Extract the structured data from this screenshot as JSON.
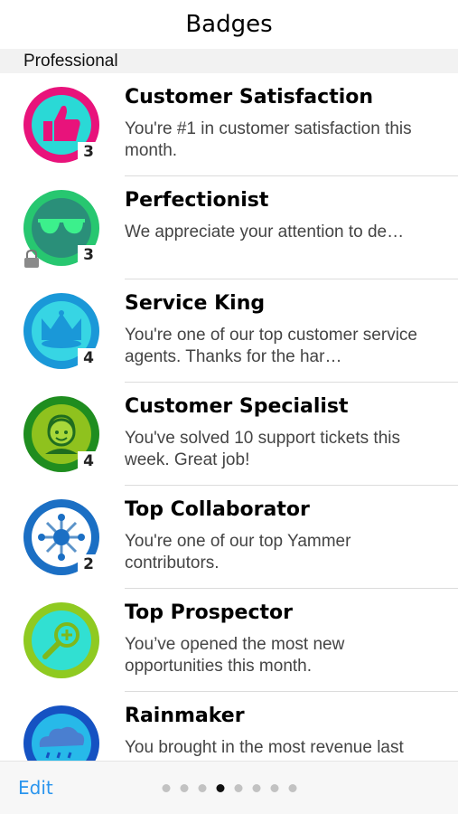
{
  "header": {
    "title": "Badges"
  },
  "section": {
    "label": "Professional"
  },
  "badges": [
    {
      "title": "Customer Satisfaction",
      "desc": "You're #1 in customer satisfaction this month.",
      "count": "3",
      "icon": "thumbs-up-icon",
      "ring": "#e8137b",
      "fill": "#2ad9d6",
      "locked": false
    },
    {
      "title": "Perfectionist",
      "desc": "We appreciate your attention to de…",
      "count": "3",
      "icon": "sunglasses-icon",
      "ring": "#27c770",
      "fill": "#2a8f79",
      "locked": true
    },
    {
      "title": "Service King",
      "desc": "You're one of our top customer service agents.  Thanks for the har…",
      "count": "4",
      "icon": "crown-icon",
      "ring": "#1a98d8",
      "fill": "#37d5e4",
      "locked": false
    },
    {
      "title": "Customer Specialist",
      "desc": "You've solved 10 support tickets this week.  Great job!",
      "count": "4",
      "icon": "headset-agent-icon",
      "ring": "#1f8d1f",
      "fill": "#8fc21e",
      "locked": false
    },
    {
      "title": "Top Collaborator",
      "desc": "You're one of our top Yammer contributors.",
      "count": "2",
      "icon": "network-icon",
      "ring": "#1b6fc4",
      "fill": "#ffffff",
      "locked": false
    },
    {
      "title": "Top Prospector",
      "desc": "You’ve opened the most new opportunities this month.",
      "count": "",
      "icon": "magnifier-plus-icon",
      "ring": "#8fca21",
      "fill": "#31e0d2",
      "locked": false
    },
    {
      "title": "Rainmaker",
      "desc": "You brought in the most revenue last",
      "count": "",
      "icon": "rain-cloud-icon",
      "ring": "#1552c2",
      "fill": "#27b9e9",
      "locked": false
    }
  ],
  "toolbar": {
    "edit_label": "Edit",
    "pages": 8,
    "active_page": 4
  }
}
